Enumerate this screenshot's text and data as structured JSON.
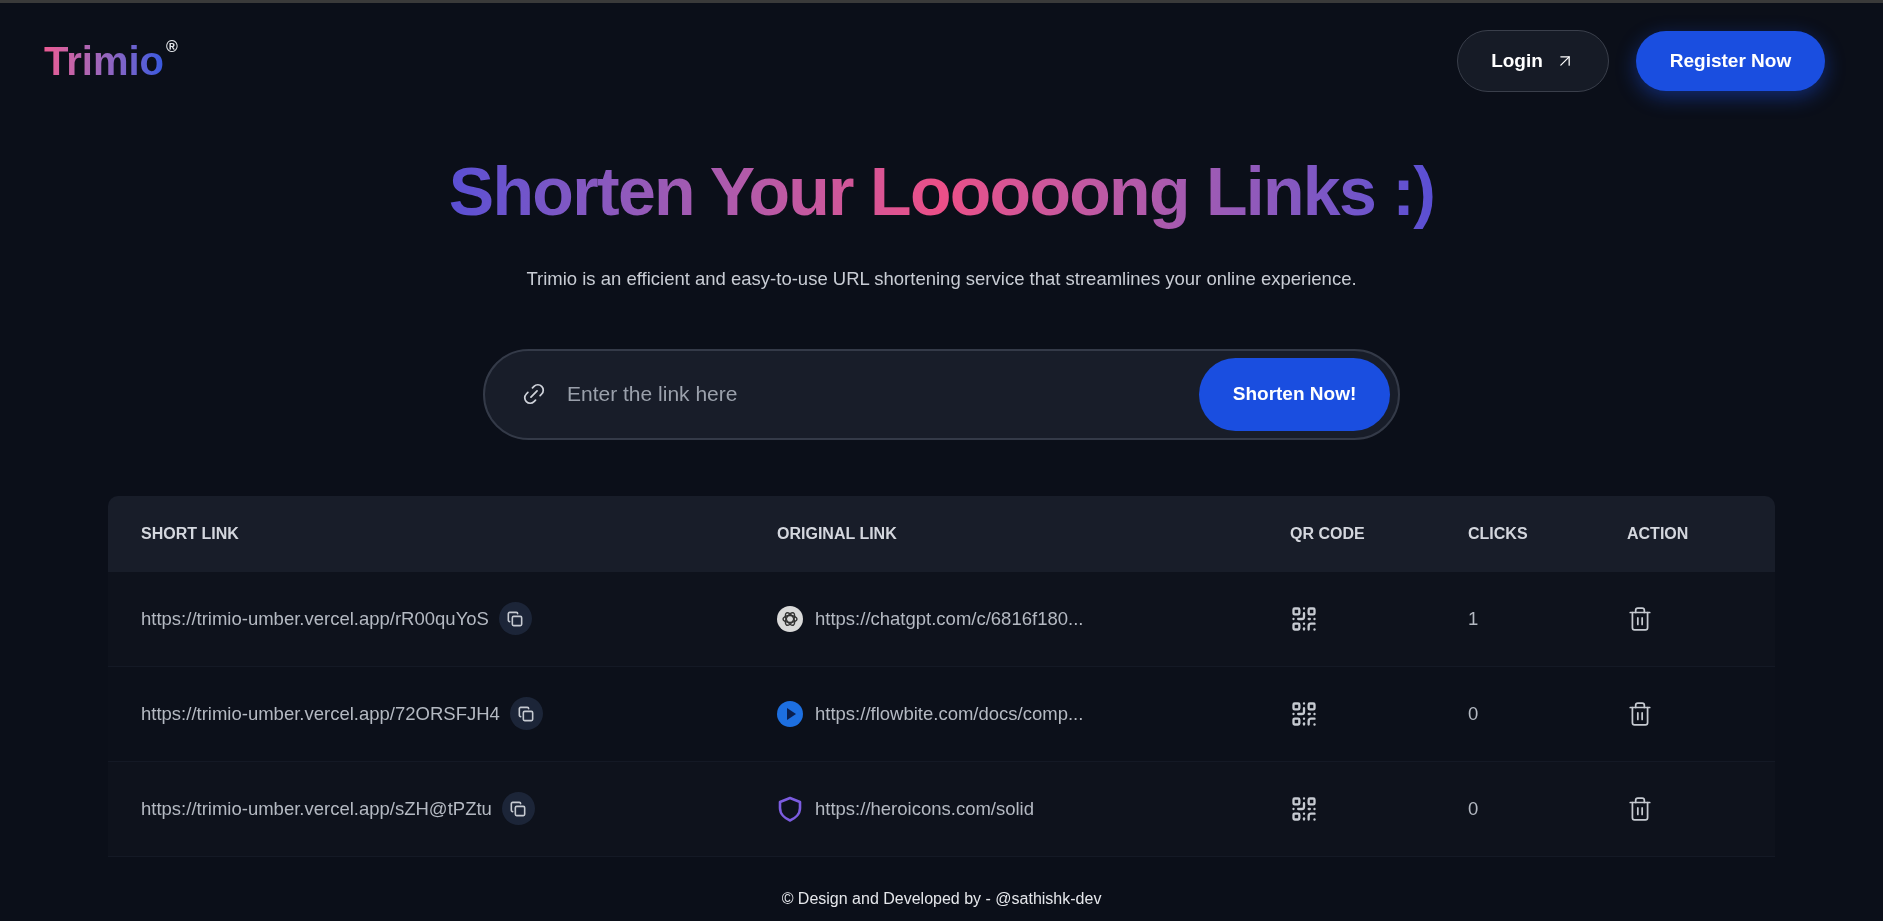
{
  "header": {
    "logo": "Trimio",
    "logo_mark": "®",
    "login": "Login",
    "register": "Register Now"
  },
  "hero": {
    "title": "Shorten Your Looooong Links :)",
    "subtitle": "Trimio is an efficient and easy-to-use URL shortening service that streamlines your online experience."
  },
  "search": {
    "placeholder": "Enter the link here",
    "button": "Shorten Now!"
  },
  "table": {
    "columns": [
      "SHORT LINK",
      "ORIGINAL LINK",
      "QR CODE",
      "CLICKS",
      "ACTION"
    ],
    "rows": [
      {
        "short_link": "https://trimio-umber.vercel.app/rR00quYoS",
        "kind": "knot",
        "original_link": "https://chatgpt.com/c/6816f180...",
        "clicks": "1"
      },
      {
        "short_link": "https://trimio-umber.vercel.app/72ORSFJH4",
        "kind": "play",
        "original_link": "https://flowbite.com/docs/comp...",
        "clicks": "0"
      },
      {
        "short_link": "https://trimio-umber.vercel.app/sZH@tPZtu",
        "kind": "shield",
        "original_link": "https://heroicons.com/solid",
        "clicks": "0"
      }
    ]
  },
  "footer": "© Design and Developed by - @sathishk-dev"
}
